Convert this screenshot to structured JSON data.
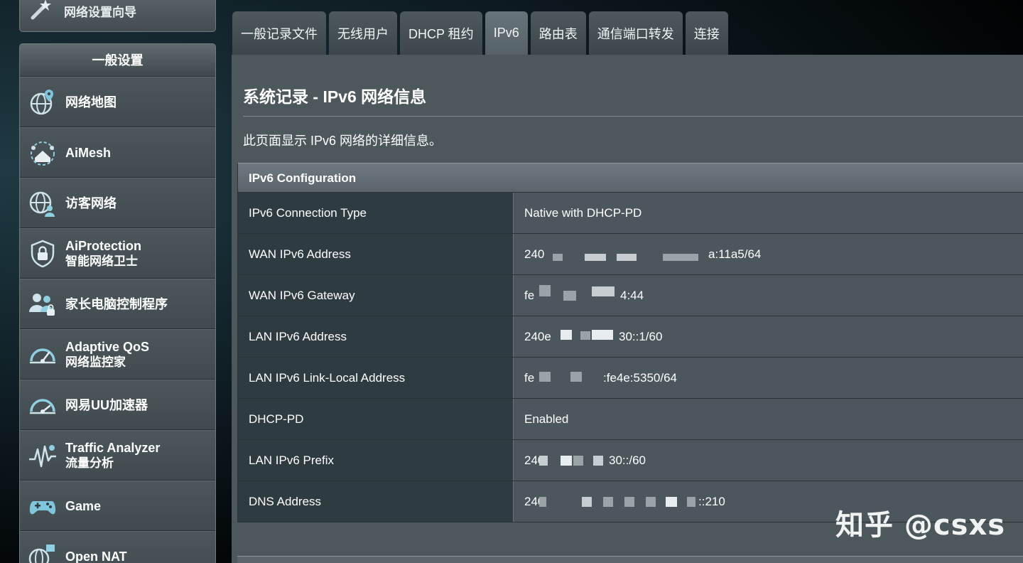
{
  "sidebar": {
    "top_item": {
      "label": "网络设置向导",
      "icon": "wizard-icon"
    },
    "header": "一般设置",
    "items": [
      {
        "line1": "网络地图",
        "line2": "",
        "icon": "globe-pin-icon"
      },
      {
        "line1": "AiMesh",
        "line2": "",
        "icon": "aimesh-icon"
      },
      {
        "line1": "访客网络",
        "line2": "",
        "icon": "guest-network-icon"
      },
      {
        "line1": "AiProtection",
        "line2": "智能网络卫士",
        "icon": "shield-lock-icon"
      },
      {
        "line1": "家长电脑控制程序",
        "line2": "",
        "icon": "parental-control-icon"
      },
      {
        "line1": "Adaptive QoS",
        "line2": "网络监控家",
        "icon": "gauge-icon"
      },
      {
        "line1": "网易UU加速器",
        "line2": "",
        "icon": "speedometer-icon"
      },
      {
        "line1": "Traffic Analyzer",
        "line2": "流量分析",
        "icon": "traffic-analyzer-icon"
      },
      {
        "line1": "Game",
        "line2": "",
        "icon": "gamepad-icon"
      },
      {
        "line1": "Open NAT",
        "line2": "",
        "icon": "open-nat-icon"
      }
    ]
  },
  "tabs": [
    {
      "label": "一般记录文件",
      "active": false
    },
    {
      "label": "无线用户",
      "active": false
    },
    {
      "label": "DHCP 租约",
      "active": false
    },
    {
      "label": "IPv6",
      "active": true
    },
    {
      "label": "路由表",
      "active": false
    },
    {
      "label": "通信端口转发",
      "active": false
    },
    {
      "label": "连接",
      "active": false
    }
  ],
  "main": {
    "title": "系统记录 - IPv6 网络信息",
    "description": "此页面显示 IPv6 网络的详细信息。",
    "table_title": "IPv6 Configuration",
    "rows": [
      {
        "label": "IPv6 Connection Type",
        "value": "Native with DHCP-PD"
      },
      {
        "label": "WAN IPv6 Address",
        "value_start": "240",
        "value_end": "a:11a5/64"
      },
      {
        "label": "WAN IPv6 Gateway",
        "value_start": "fe",
        "value_end": "4:44"
      },
      {
        "label": "LAN IPv6 Address",
        "value_start": "240e",
        "value_end": "30::1/60"
      },
      {
        "label": "LAN IPv6 Link-Local Address",
        "value_start": "fe",
        "value_end": ":fe4e:5350/64"
      },
      {
        "label": "DHCP-PD",
        "value": "Enabled"
      },
      {
        "label": "LAN IPv6 Prefix",
        "value_start": "240",
        "value_end": "30::/60"
      },
      {
        "label": "DNS Address",
        "value_start": "240",
        "value_end": "::210"
      }
    ]
  },
  "watermark": "知乎 @csxs",
  "colors": {
    "panel": "#4d585d",
    "label_cell": "#2e3b40",
    "value_cell": "#4b575c",
    "tab_active": "#5f6b70"
  }
}
